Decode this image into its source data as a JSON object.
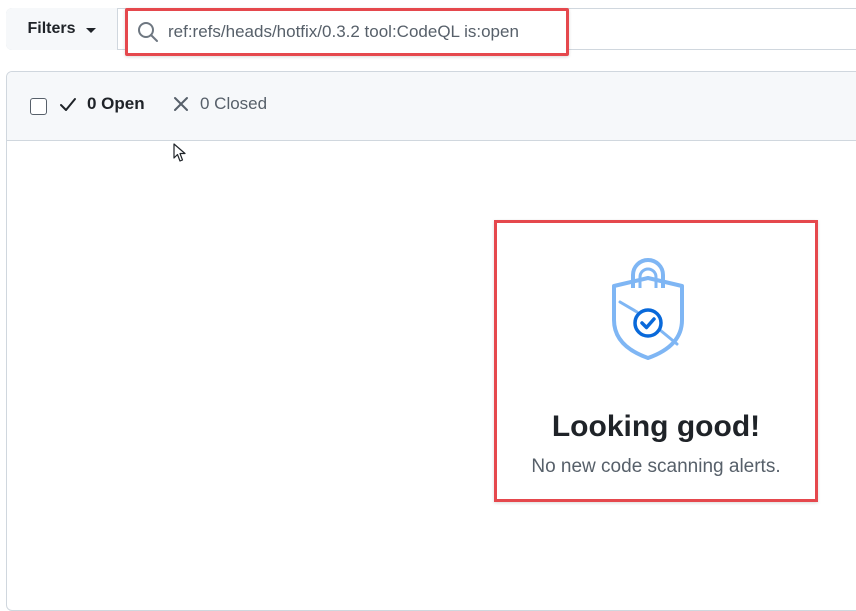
{
  "toolbar": {
    "filters_label": "Filters",
    "search_value": "ref:refs/heads/hotfix/0.3.2 tool:CodeQL is:open"
  },
  "states": {
    "open_label": "0 Open",
    "closed_label": "0 Closed"
  },
  "blank_state": {
    "icon": "shield-check-icon",
    "title": "Looking good!",
    "description": "No new code scanning alerts."
  },
  "colors": {
    "highlight": "#e5484d",
    "accent": "#0969da",
    "icon_light": "#7fb6f4"
  }
}
